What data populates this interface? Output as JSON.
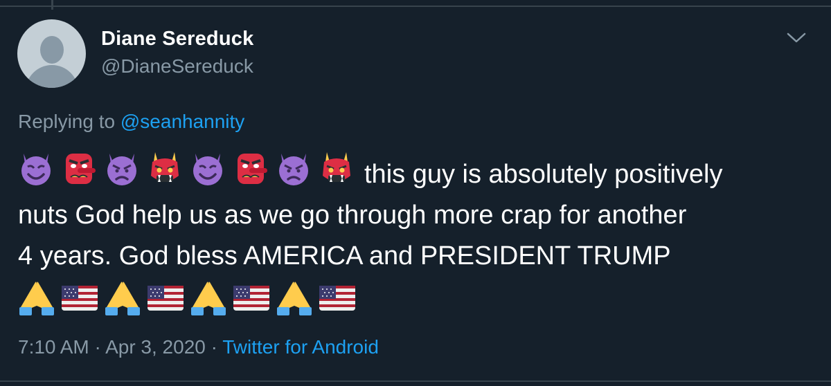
{
  "tweet": {
    "display_name": "Diane Sereduck",
    "handle": "@DianeSereduck",
    "replying_prefix": "Replying to",
    "replying_to": "@seanhannity",
    "text_after_emojis": "this guy is absolutely positively",
    "text_line2": "nuts God help us as we go through more crap for another",
    "text_line3": "4 years. God bless AMERICA and PRESIDENT TRUMP",
    "leading_emojis": [
      "smiling-devil",
      "tengu",
      "angry-devil",
      "ogre",
      "smiling-devil",
      "tengu",
      "angry-devil",
      "ogre"
    ],
    "trailing_emojis": [
      "folded-hands",
      "us-flag",
      "folded-hands",
      "us-flag",
      "folded-hands",
      "us-flag",
      "folded-hands",
      "us-flag"
    ],
    "time": "7:10 AM",
    "separator": "·",
    "date": "Apr 3, 2020",
    "source": "Twitter for Android"
  },
  "colors": {
    "background": "#15202b",
    "primary_text": "#ffffff",
    "secondary_text": "#8899a6",
    "link": "#1da1f2",
    "border": "#38444d"
  },
  "icons": {
    "menu": "chevron-down-icon",
    "avatar": "default-avatar"
  }
}
